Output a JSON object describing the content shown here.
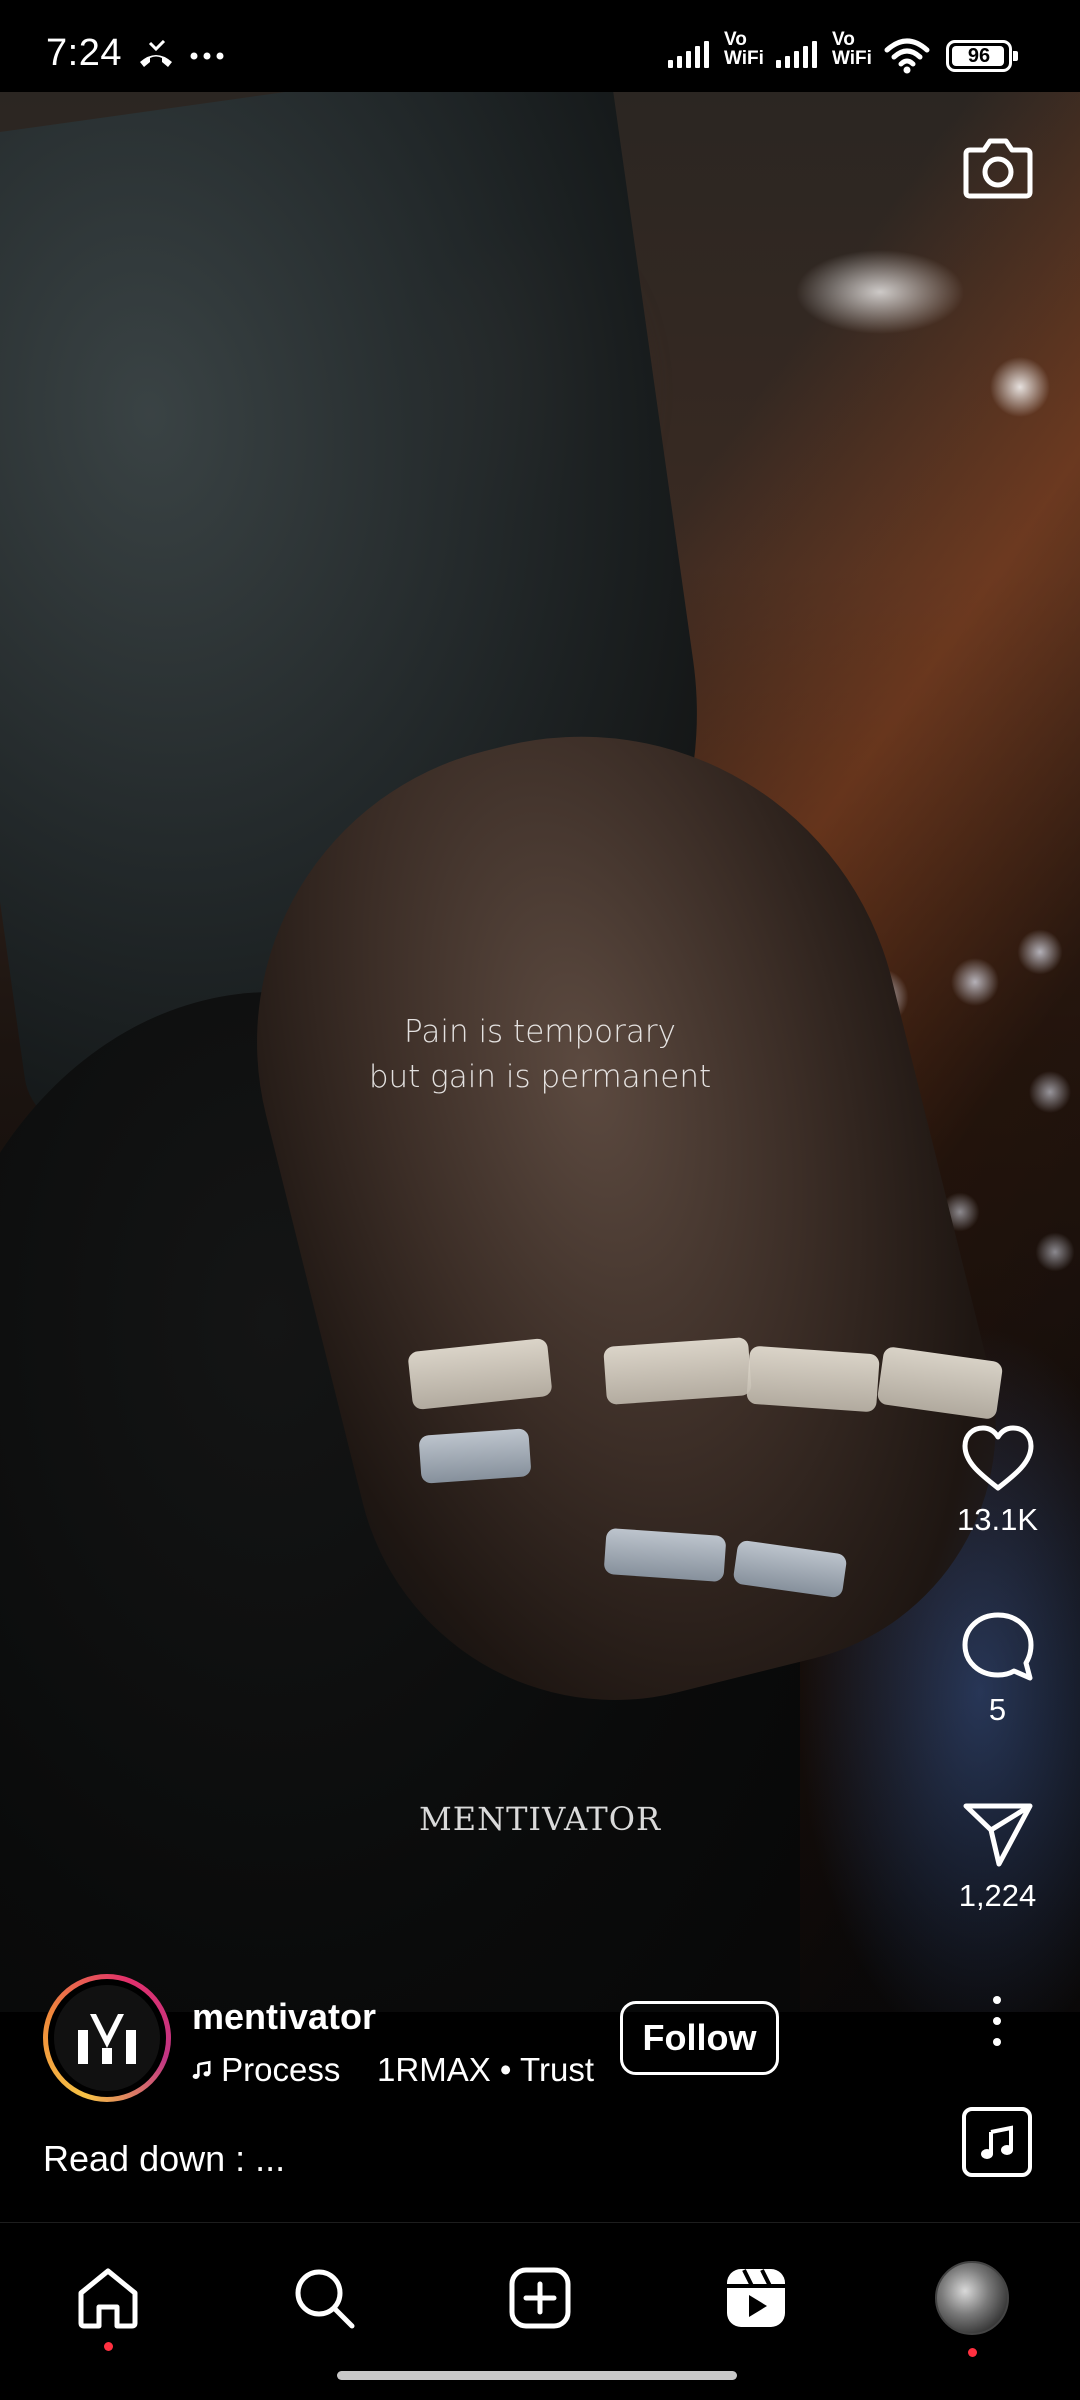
{
  "status_bar": {
    "time": "7:24",
    "network_1": "Vo\nWiFi",
    "network_2": "Vo\nWiFi",
    "battery": "96",
    "icons": [
      "missed-call-icon",
      "more-dots-icon",
      "signal-icon",
      "wifi-icon",
      "battery-icon"
    ]
  },
  "reel": {
    "quote_line1": "Pain is temporary",
    "quote_line2": "but gain is permanent",
    "watermark": "MENTIVATOR"
  },
  "actions": {
    "likes": "13.1K",
    "comments": "5",
    "shares": "1,224"
  },
  "author": {
    "username": "mentivator",
    "audio_text": "Process    1RMAX • Trust",
    "follow_label": "Follow",
    "caption": "Read down : ..."
  },
  "nav": {
    "items": [
      "home",
      "search",
      "create",
      "reels",
      "profile"
    ],
    "active": "reels"
  },
  "colors": {
    "background": "#000000",
    "notification_dot": "#ff3040",
    "avatar_ring": [
      "#f6c245",
      "#f08a3a",
      "#e1306c",
      "#c13584"
    ]
  }
}
